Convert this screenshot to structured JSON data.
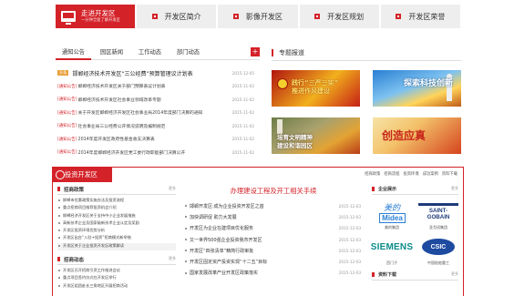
{
  "nav": {
    "main_title": "走进开发区",
    "main_subtitle": "一分钟全面了解开发区",
    "tabs": [
      "开发区简介",
      "影像开发区",
      "开发区规划",
      "开发区荣誉"
    ]
  },
  "notices": {
    "tabs": [
      "通知公告",
      "园区新闻",
      "工作动态",
      "部门动态"
    ],
    "items": [
      {
        "tag": "头条",
        "title": "邯郸经济技术开发区“三公经费”预算管理议计划表",
        "date": "2015-12-05"
      },
      {
        "tag": "[通知公告]",
        "title": "邯郸经济技术开发区关于部门预算表议计划表",
        "date": "2015-11-02"
      },
      {
        "tag": "[通知公告]",
        "title": "邯郸经济技术开发区社会事业领域改革专题",
        "date": "2015-11-02"
      },
      {
        "tag": "[通知公告]",
        "title": "关于开发区邯郸经济开发区社会事业局2014年度部门决算的通知",
        "date": "2015-11-02"
      },
      {
        "tag": "[通知公告]",
        "title": "社会事业局三公经费公开情况说明及编制规范",
        "date": "2015-11-02"
      },
      {
        "tag": "[通知公告]",
        "title": "2014年度开发区政府性基金收支决算表",
        "date": "2015-11-02"
      },
      {
        "tag": "[通知公告]",
        "title": "2014年度邯郸经济开发区党工委行政职能部门决算公开",
        "date": "2015-11-02"
      }
    ]
  },
  "special": {
    "heading": "专题报道",
    "banners": [
      {
        "text1": "践行“三严三实”",
        "text2": "推进作风建设"
      },
      {
        "text1": "探索科技创新"
      },
      {
        "text1": "培育文明精神",
        "text2": "建设和谐园区"
      },
      {
        "text1": "创造应真"
      }
    ]
  },
  "invest": {
    "title": "投资开发区",
    "links": [
      "招商政策",
      "招商流程",
      "投资环境",
      "成功案例",
      "资料下载"
    ],
    "policy_head": "招商政策",
    "policy": [
      "邯郸市优惠政策实施办法及投资流程",
      "重点招商项目推荐投资机会介绍",
      "邯郸经济开发区关于支持中小企业发展措施",
      "高新技术企业及国家级新技术企业认定及奖励",
      "开发区投资环境优势分析",
      "开发区出台“入驻+投资”招商模式新举措",
      "开发区关于企业投资开发区政策解读"
    ],
    "dynamic_head": "招商动态",
    "dynamic": [
      "开发区召开招商引资工作推进会议",
      "重点项目签约仪式在开发区举行",
      "开发区组团赴长三角地区开展招商活动"
    ],
    "mid_head": "办理建设工程及开工相关手续",
    "news": [
      {
        "title": "邯郸开发区:成为企业投资开发区之首",
        "date": "2015-12-03"
      },
      {
        "title": "加快调研促 助力大发展",
        "date": "2015-12-03"
      },
      {
        "title": "开发区为企业在建项目优化服务",
        "date": "2015-12-03"
      },
      {
        "title": "又一世界500强企业投资我市开发区",
        "date": "2015-12-03"
      },
      {
        "title": "开发区“四张清单”精简行政审批",
        "date": "2015-12-03"
      },
      {
        "title": "开发区固定资产投资实现“十二五”目标",
        "date": "2015-12-03"
      },
      {
        "title": "国家发展改革产业开发区政策落实",
        "date": "2015-12-03"
      }
    ],
    "partners_head": "企业展示",
    "partners": [
      "美的集团",
      "圣戈班集团",
      "西门子",
      "中国船舶重工"
    ],
    "resources_head": "资料下载"
  }
}
